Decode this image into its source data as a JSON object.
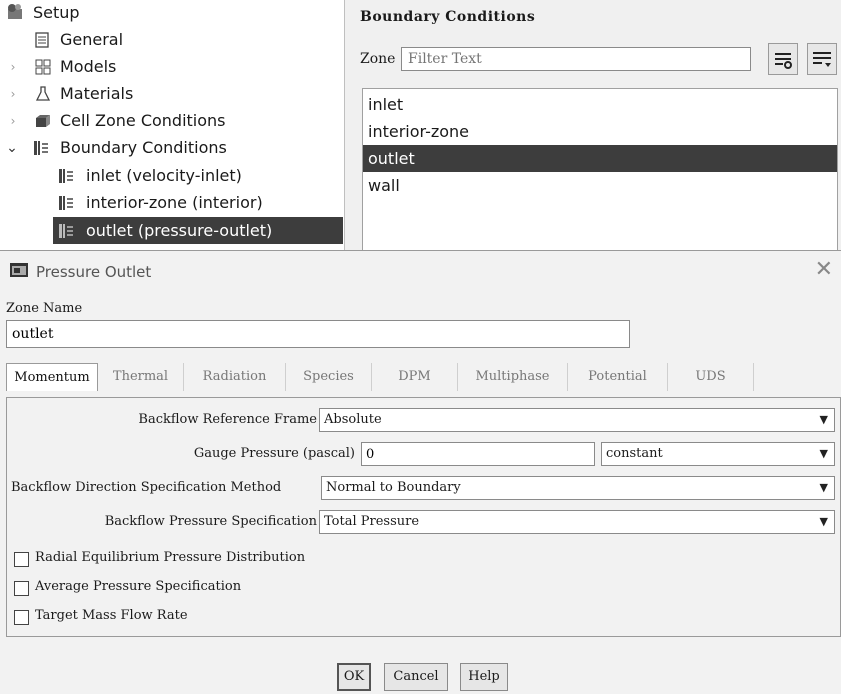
{
  "tree": {
    "setup": "Setup",
    "general": "General",
    "models": "Models",
    "materials": "Materials",
    "cell_zone": "Cell Zone Conditions",
    "boundary": "Boundary Conditions",
    "items": [
      "inlet (velocity-inlet)",
      "interior-zone (interior)",
      "outlet (pressure-outlet)"
    ]
  },
  "bc_panel": {
    "title": "Boundary Conditions",
    "zone_label": "Zone",
    "filter_placeholder": "Filter Text",
    "zones": [
      "inlet",
      "interior-zone",
      "outlet",
      "wall"
    ],
    "selected_zone": "outlet"
  },
  "dialog": {
    "title": "Pressure Outlet",
    "zone_name_label": "Zone Name",
    "zone_name_value": "outlet",
    "tabs": [
      "Momentum",
      "Thermal",
      "Radiation",
      "Species",
      "DPM",
      "Multiphase",
      "Potential",
      "UDS"
    ],
    "active_tab": "Momentum",
    "fields": {
      "backflow_ref_frame_label": "Backflow Reference Frame",
      "backflow_ref_frame_value": "Absolute",
      "gauge_pressure_label": "Gauge Pressure (pascal)",
      "gauge_pressure_value": "0",
      "gauge_pressure_method": "constant",
      "backflow_dir_label": "Backflow Direction Specification Method",
      "backflow_dir_value": "Normal to Boundary",
      "backflow_pressure_label": "Backflow Pressure Specification",
      "backflow_pressure_value": "Total Pressure"
    },
    "checkboxes": [
      "Radial Equilibrium Pressure Distribution",
      "Average Pressure Specification",
      "Target Mass Flow Rate"
    ],
    "buttons": {
      "ok": "OK",
      "cancel": "Cancel",
      "help": "Help"
    },
    "close_glyph": "✕"
  },
  "colors": {
    "selection": "#3d3d3d",
    "dialog_bg": "#f2f2f2"
  }
}
